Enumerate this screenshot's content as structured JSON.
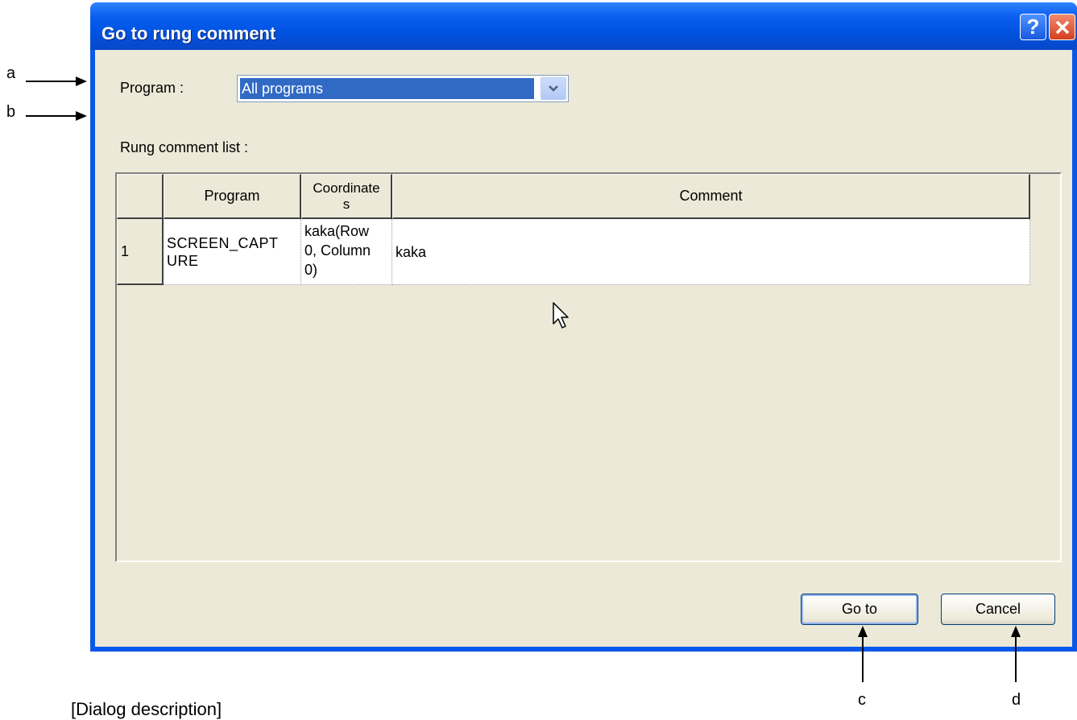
{
  "dialog": {
    "title": "Go to rung comment",
    "help_label": "?",
    "close_label": "X",
    "program_label": "Program :",
    "program_selected": "All programs",
    "list_label": "Rung comment list :",
    "goto_label": "Go to",
    "cancel_label": "Cancel"
  },
  "table": {
    "headers": [
      "Program",
      "Coordinate\ns",
      "Comment"
    ],
    "rows": [
      {
        "num": "1",
        "program": "SCREEN_CAPT\nURE",
        "coordinates": "kaka(Row\n0, Column\n0)",
        "comment": "kaka"
      }
    ]
  },
  "annotations": {
    "a": "a",
    "b": "b",
    "c": "c",
    "d": "d"
  },
  "caption": "[Dialog description]",
  "icons": {
    "dropdown": "chevron-down-icon",
    "cursor": "mouse-pointer-icon",
    "help": "help-icon",
    "close": "close-icon"
  }
}
